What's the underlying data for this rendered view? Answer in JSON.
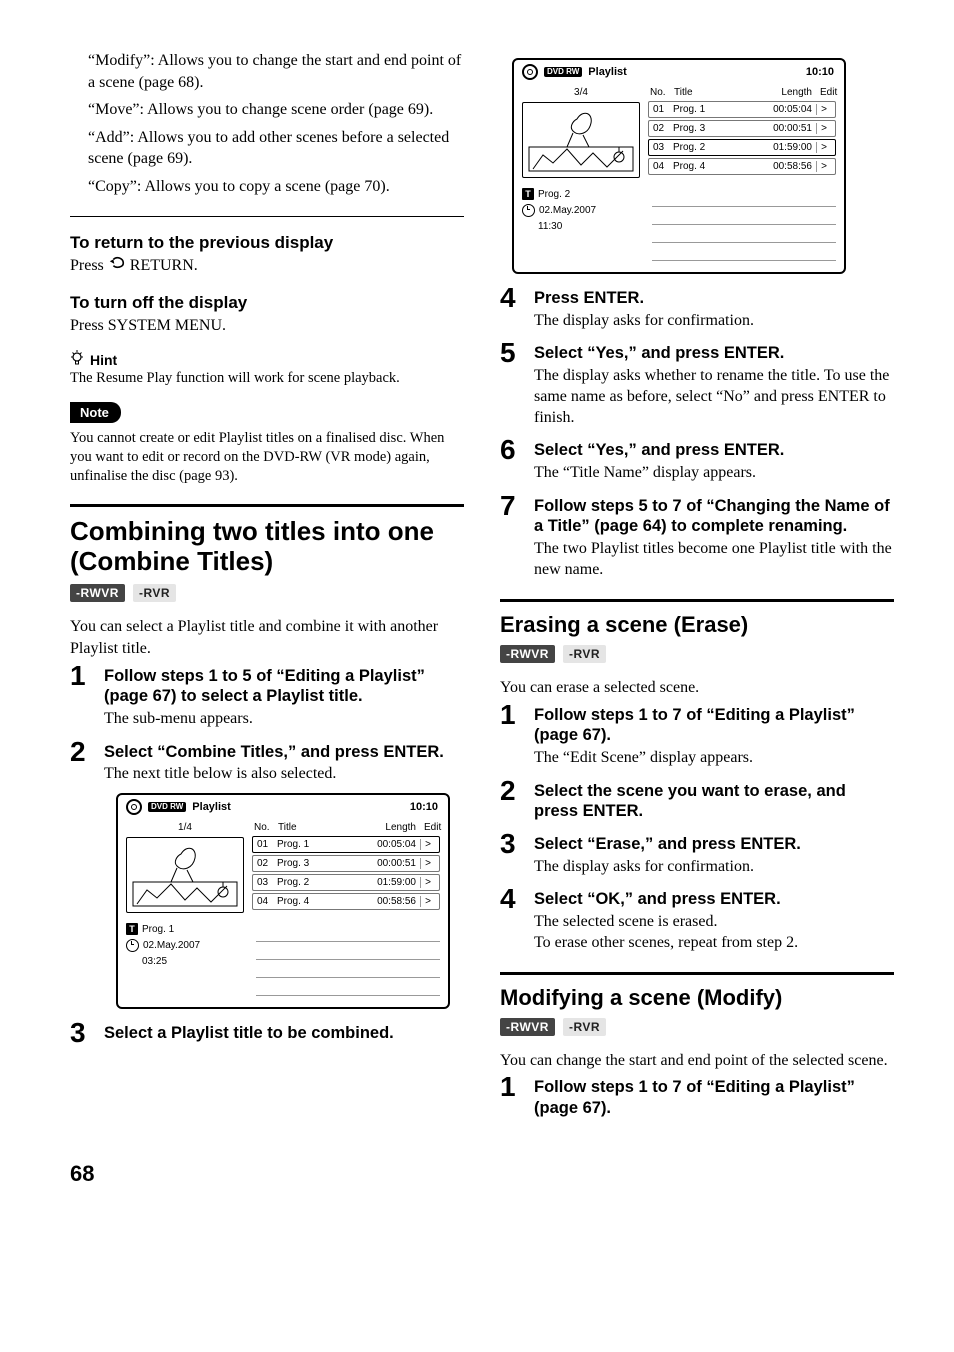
{
  "left": {
    "intro": [
      "“Modify”: Allows you to change the start and end point of a scene (page 68).",
      "“Move”: Allows you to change scene order (page 69).",
      "“Add”: Allows you to add other scenes before a selected scene (page 69).",
      "“Copy”: Allows you to copy a scene (page 70)."
    ],
    "return_head": "To return to the previous display",
    "return_body_pre": "Press ",
    "return_body_post": " RETURN.",
    "off_head": "To turn off the display",
    "off_body": "Press SYSTEM MENU.",
    "hint_label": "Hint",
    "hint_body": "The Resume Play function will work for scene playback.",
    "note_label": "Note",
    "note_body": "You cannot create or edit Playlist titles on a finalised disc. When you want to edit or record on the DVD-RW (VR mode) again, unfinalise the disc (page 93).",
    "combine_title": "Combining two titles into one (Combine Titles)",
    "combine_intro": "You can select a Playlist title and combine it with another Playlist title.",
    "steps": [
      {
        "head": "Follow steps 1 to 5 of “Editing a Playlist” (page 67) to select a Playlist title.",
        "body": "The sub-menu appears."
      },
      {
        "head": "Select “Combine Titles,” and press ENTER.",
        "body": "The next title below is also selected."
      },
      {
        "head": "Select a Playlist title to be combined.",
        "body": ""
      }
    ]
  },
  "right": {
    "steps_a": [
      {
        "head": "Press ENTER.",
        "body": "The display asks for confirmation."
      },
      {
        "head": "Select “Yes,” and press ENTER.",
        "body": "The display asks whether to rename the title. To use the same name as before, select “No” and press ENTER to finish."
      },
      {
        "head": "Select “Yes,” and press ENTER.",
        "body": "The “Title Name” display appears."
      },
      {
        "head": "Follow steps 5 to 7 of “Changing the Name of a Title” (page 64) to complete renaming.",
        "body": "The two Playlist titles become one Playlist title with the new name."
      }
    ],
    "erase_title": "Erasing a scene (Erase)",
    "erase_intro": "You can erase a selected scene.",
    "erase_steps": [
      {
        "head": "Follow steps 1 to 7 of “Editing a Playlist” (page 67).",
        "body": "The “Edit Scene” display appears."
      },
      {
        "head": "Select the scene you want to erase, and press ENTER.",
        "body": ""
      },
      {
        "head": "Select “Erase,” and press ENTER.",
        "body": "The display asks for confirmation."
      },
      {
        "head": "Select “OK,” and press ENTER.",
        "body": "The selected scene is erased.\nTo erase other scenes, repeat from step 2."
      }
    ],
    "modify_title": "Modifying a scene (Modify)",
    "modify_intro": "You can change the start and end point of the selected scene.",
    "modify_steps": [
      {
        "head": "Follow steps 1 to 7 of “Editing a Playlist” (page 67).",
        "body": ""
      }
    ]
  },
  "badges": {
    "rw": "-RWVR",
    "r": "-RVR"
  },
  "playlist_common": {
    "title": "Playlist",
    "time": "10:10",
    "dvdrw": "DVD RW",
    "head_no": "No.",
    "head_title": "Title",
    "head_length": "Length",
    "head_edit": "Edit",
    "rows": [
      {
        "no": "01",
        "title": "Prog. 1",
        "len": "00:05:04"
      },
      {
        "no": "02",
        "title": "Prog. 3",
        "len": "00:00:51"
      },
      {
        "no": "03",
        "title": "Prog. 2",
        "len": "01:59:00"
      },
      {
        "no": "04",
        "title": "Prog. 4",
        "len": "00:58:56"
      }
    ]
  },
  "playlist1": {
    "counter": "1/4",
    "selected": 0,
    "prog": "Prog. 1",
    "date": "02.May.2007",
    "dur": "03:25"
  },
  "playlist2": {
    "counter": "3/4",
    "selected": 2,
    "prog": "Prog. 2",
    "date": "02.May.2007",
    "dur": "11:30"
  },
  "page_number": "68"
}
